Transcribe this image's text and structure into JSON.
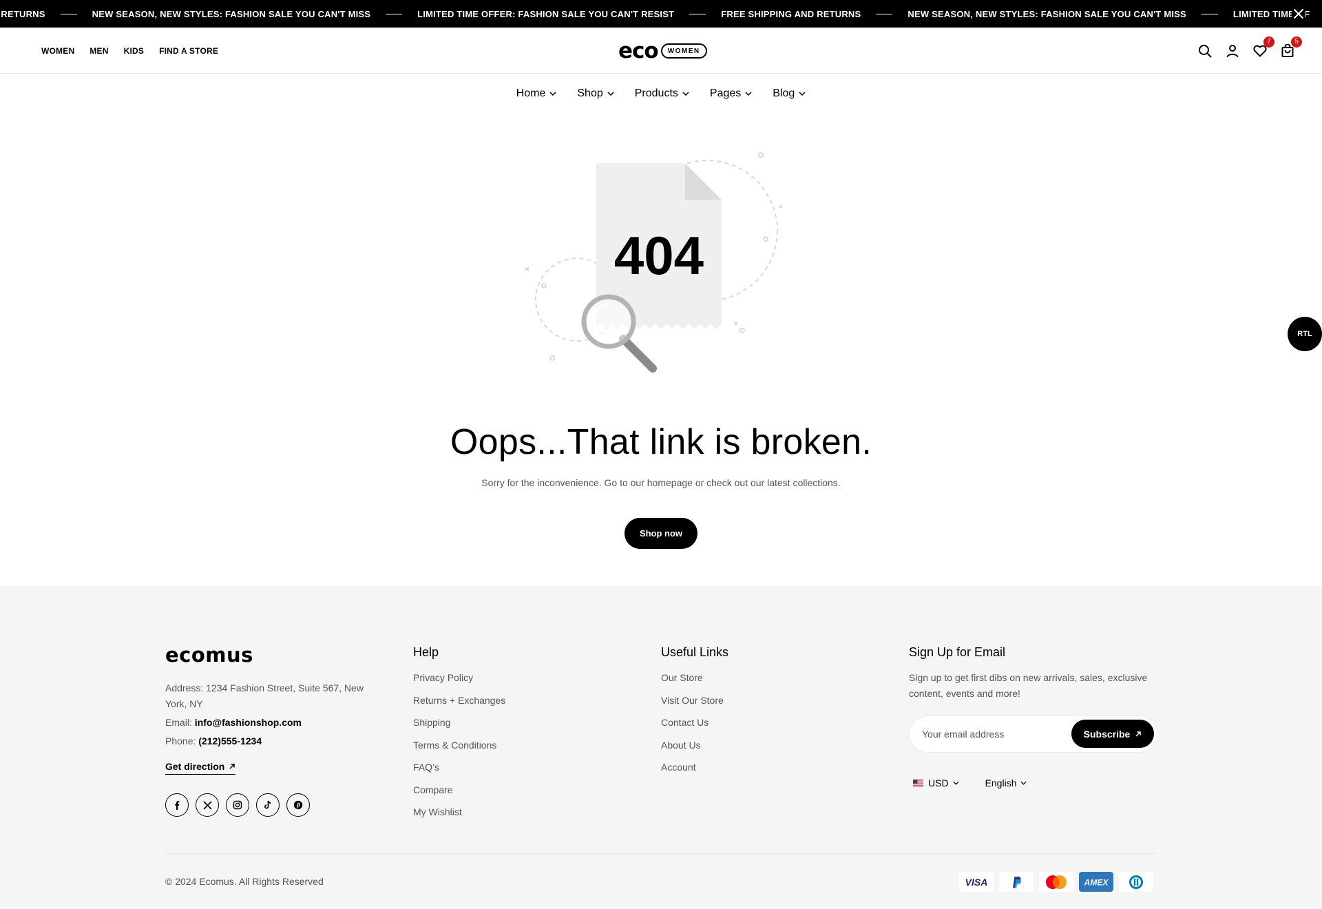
{
  "announcement": {
    "items": [
      "D RETURNS",
      "NEW SEASON, NEW STYLES: FASHION SALE YOU CAN'T MISS",
      "LIMITED TIME OFFER: FASHION SALE YOU CAN'T RESIST",
      "FREE SHIPPING AND RETURNS",
      "NEW SEASON, NEW STYLES: FASHION SALE YOU CAN'T MISS",
      "LIMITED TIME OF"
    ]
  },
  "header": {
    "top_links": [
      "WOMEN",
      "MEN",
      "KIDS",
      "FIND A STORE"
    ],
    "logo_text": "eco",
    "logo_badge": "WOMEN",
    "wishlist_count": "7",
    "cart_count": "5"
  },
  "nav": {
    "items": [
      "Home",
      "Shop",
      "Products",
      "Pages",
      "Blog"
    ]
  },
  "error": {
    "code": "404",
    "title": "Oops...That link is broken.",
    "subtitle": "Sorry for the inconvenience. Go to our homepage or check out our latest collections.",
    "button": "Shop now"
  },
  "rtl_label": "RTL",
  "footer": {
    "logo_text": "ecomus",
    "address": "Address: 1234 Fashion Street, Suite 567, New York, NY",
    "email_label": "Email: ",
    "email": "info@fashionshop.com",
    "phone_label": "Phone: ",
    "phone": "(212)555-1234",
    "direction": "Get direction",
    "help": {
      "title": "Help",
      "links": [
        "Privacy Policy",
        "Returns + Exchanges",
        "Shipping",
        "Terms & Conditions",
        "FAQ’s",
        "Compare",
        "My Wishlist"
      ]
    },
    "useful": {
      "title": "Useful Links",
      "links": [
        "Our Store",
        "Visit Our Store",
        "Contact Us",
        "About Us",
        "Account"
      ]
    },
    "newsletter": {
      "title": "Sign Up for Email",
      "text": "Sign up to get first dibs on new arrivals, sales, exclusive content, events and more!",
      "placeholder": "Your email address",
      "button": "Subscribe"
    },
    "currency": "USD",
    "language": "English",
    "copyright": "© 2024 Ecomus. All Rights Reserved",
    "payment_methods": [
      "VISA",
      "PayPal",
      "Mastercard",
      "AMEX",
      "Diners"
    ]
  }
}
